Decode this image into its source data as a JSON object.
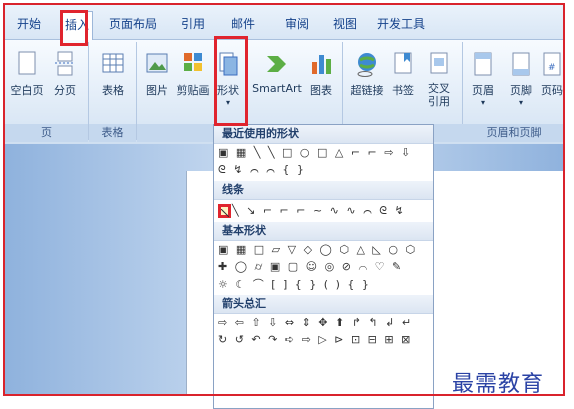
{
  "tabs": [
    "开始",
    "插入",
    "页面布局",
    "引用",
    "邮件",
    "审阅",
    "视图",
    "开发工具"
  ],
  "active_tab": "插入",
  "ribbon": {
    "groups": [
      "页",
      "表格",
      "页眉和页脚"
    ],
    "buttons": {
      "blank": "空白页",
      "page": "分页",
      "table": "表格",
      "picture": "图片",
      "clipart": "剪贴画",
      "shape": "形状",
      "smartart": "SmartArt",
      "chart": "图表",
      "hyperlink": "超链接",
      "bookmark": "书签",
      "crossref": "交叉\n引用",
      "header": "页眉",
      "footer": "页脚",
      "pagenum": "页码"
    }
  },
  "dropdown": {
    "sections": [
      "最近使用的形状",
      "线条",
      "基本形状",
      "箭头总汇"
    ],
    "recent_row1": "▣ ▦ ╲ ╲ □ ○ □ △ ⌐ ⌐ ⇨ ⇩",
    "recent_row2": "ᘓ ↯ ⌒ ⌒ { }",
    "lines_row": "╲ ↘ ⌐ ⌐ ⌐ ~ ∿ ∿ ⌒ ᘓ ↯",
    "basic_row1": "▣ ▦ □ ▱ ▽ ◇ ◯ ⬡ △ ◺ ○ ⬡",
    "basic_row2": "✚ ◯ ⌭ ▣ ▢ ☺ ◎ ⊘ ⌒ ♡ ✎",
    "basic_row3": "☼ ☾ ⌒ [ ] { } ( ) { }",
    "arrows_row1": "⇨ ⇦ ⇧ ⇩ ⇔ ⇕ ✥ ⬆ ↱ ↰ ↲ ↵",
    "arrows_row2": "↻ ↺ ↶ ↷ ➪ ⇨ ▷ ⊳ ⊡ ⊟ ⊞ ⊠"
  },
  "watermark": "最需教育"
}
